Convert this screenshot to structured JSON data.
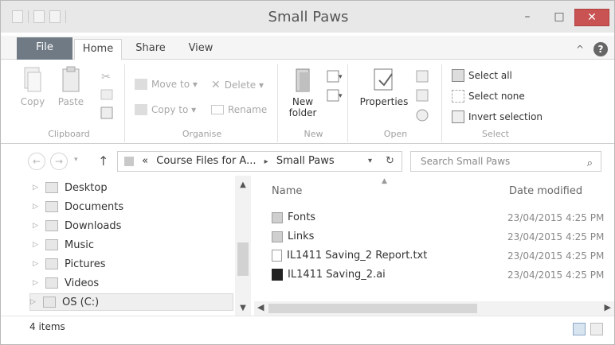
{
  "window": {
    "title": "Small Paws",
    "minimize": "–",
    "maximize": "□",
    "close": "✕"
  },
  "ribbon_tabs": [
    "File",
    "Home",
    "Share",
    "View"
  ],
  "ribbon_right": {
    "collapse": "^",
    "help": "?"
  },
  "ribbon": {
    "clipboard": {
      "label": "Clipboard",
      "copy": "Copy",
      "paste": "Paste"
    },
    "organise": {
      "label": "Organise",
      "move_to": "Move to ▾",
      "copy_to": "Copy to ▾",
      "delete": "Delete ▾",
      "rename": "Rename"
    },
    "new": {
      "label": "New",
      "new_folder": "New folder"
    },
    "open": {
      "label": "Open",
      "properties": "Properties"
    },
    "select": {
      "label": "Select",
      "select_all": "Select all",
      "select_none": "Select none",
      "invert_selection": "Invert selection"
    }
  },
  "address": {
    "path_prefix": "«",
    "crumbs": [
      "Course Files for A...",
      "Small Paws"
    ],
    "search_placeholder": "Search Small Paws"
  },
  "nav_pane": {
    "items": [
      {
        "label": "Desktop"
      },
      {
        "label": "Documents"
      },
      {
        "label": "Downloads"
      },
      {
        "label": "Music"
      },
      {
        "label": "Pictures"
      },
      {
        "label": "Videos"
      },
      {
        "label": "OS (C:)"
      }
    ]
  },
  "file_list": {
    "columns": {
      "name": "Name",
      "date": "Date modified"
    },
    "files": [
      {
        "name": "Fonts",
        "date": "23/04/2015 4:25 PM"
      },
      {
        "name": "Links",
        "date": "23/04/2015 4:25 PM"
      },
      {
        "name": "IL1411 Saving_2 Report.txt",
        "date": "23/04/2015 4:25 PM"
      },
      {
        "name": "IL1411 Saving_2.ai",
        "date": "23/04/2015 4:25 PM"
      }
    ]
  },
  "status": {
    "item_count": "4 items"
  }
}
